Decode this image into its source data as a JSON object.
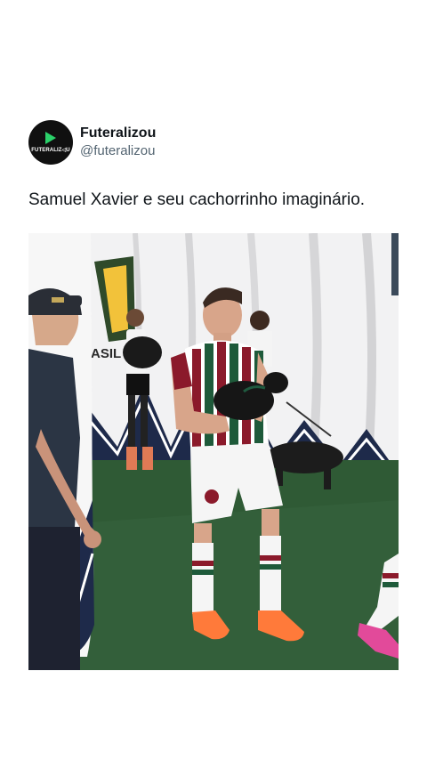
{
  "author": {
    "display_name": "Futeralizou",
    "handle": "@futeralizou",
    "avatar_logo_text": "FUTERALIZ◁U",
    "avatar_icon": "play-triangle-icon"
  },
  "tweet": {
    "text": "Samuel Xavier e seu cachorrinho imaginário."
  },
  "media": {
    "type": "video-frame",
    "banner_text": "ASIL"
  },
  "colors": {
    "text_primary": "#0f1419",
    "text_secondary": "#536471",
    "avatar_bg": "#101010",
    "avatar_accent": "#2bd16a",
    "grass": "#2f5a35",
    "jersey_maroon": "#8b1a2b",
    "jersey_green": "#1e5a3a",
    "boots": "#ff7a3a"
  }
}
